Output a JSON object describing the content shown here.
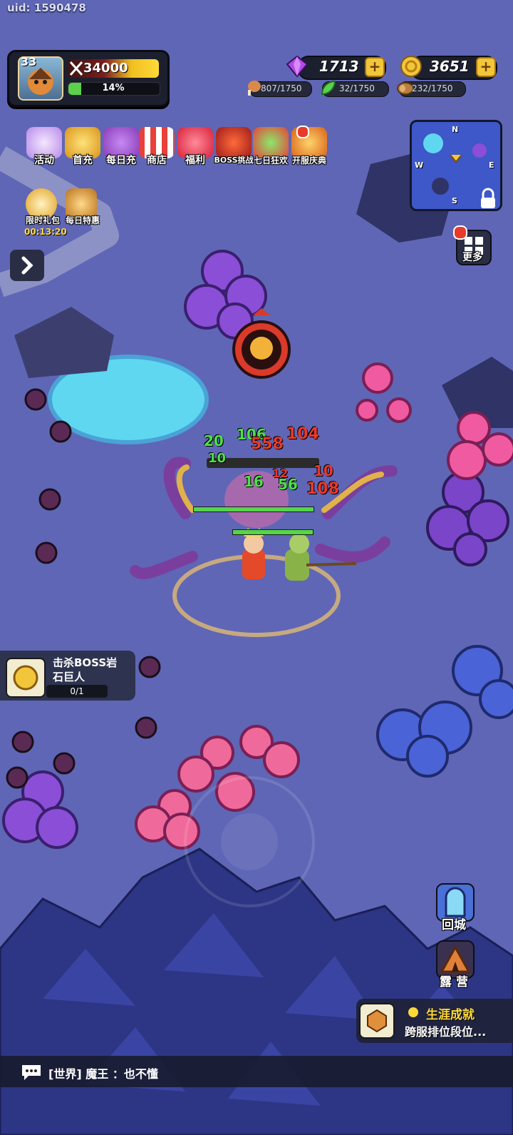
{
  "uid": "uid: 1590478",
  "player": {
    "level": "33",
    "power": "34000",
    "exp_percent": "14%",
    "exp_fraction": 0.14
  },
  "currency": {
    "gems": "1713",
    "gold": "3651"
  },
  "resources": {
    "meat": "807/1750",
    "herb": "32/1750",
    "wood": "232/1750"
  },
  "menu": {
    "events": "活动",
    "first_recharge": "首充",
    "daily_recharge": "每日充",
    "shop": "商店",
    "welfare": "福利",
    "boss_challenge": "BOSS挑战",
    "seven_day": "七日狂欢",
    "server_celebration": "开服庆典",
    "limited_pack": "限时礼包",
    "limited_timer": "00:13:20",
    "daily_deal": "每日特惠"
  },
  "minimap": {
    "n": "N",
    "s": "S",
    "w": "W",
    "e": "E"
  },
  "more_label": "更多",
  "quest": {
    "line1": "击杀BOSS岩",
    "line2": "石巨人",
    "progress": "0/1"
  },
  "return_city": "回城",
  "camp": "露 营",
  "achievement": {
    "title": "生涯成就",
    "subtitle": "跨服排位段位..."
  },
  "chat": {
    "channel": "[世界]",
    "sender": "魔王",
    "message": "：也不懂"
  },
  "damage_numbers": {
    "green": [
      "20",
      "10",
      "106",
      "56",
      "16"
    ],
    "red": [
      "558",
      "104",
      "10",
      "108",
      "12"
    ]
  },
  "colors": {
    "ground": "#5f66b6",
    "panel": "#1c1f2e",
    "gold_accent": "#f2c63b",
    "exp_green": "#5bd14d",
    "damage_green": "#4fe04a",
    "damage_red": "#e83a2a"
  }
}
